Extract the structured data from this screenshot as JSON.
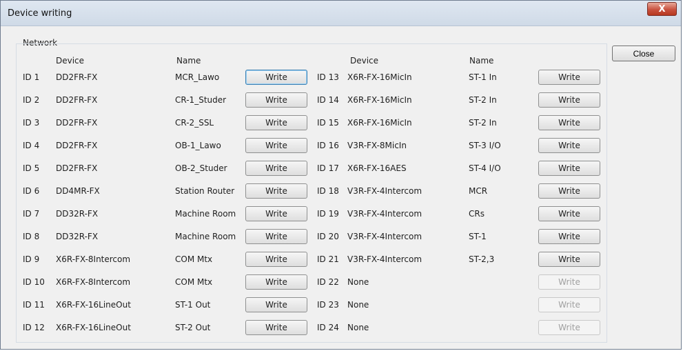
{
  "window": {
    "title": "Device writing",
    "close_glyph": "X"
  },
  "network": {
    "group_label": "Network",
    "headers": {
      "device": "Device",
      "name": "Name"
    },
    "left": [
      {
        "id": "ID 1",
        "device": "DD2FR-FX",
        "name": "MCR_Lawo",
        "write": "Write",
        "enabled": true
      },
      {
        "id": "ID 2",
        "device": "DD2FR-FX",
        "name": "CR-1_Studer",
        "write": "Write",
        "enabled": true
      },
      {
        "id": "ID 3",
        "device": "DD2FR-FX",
        "name": "CR-2_SSL",
        "write": "Write",
        "enabled": true
      },
      {
        "id": "ID 4",
        "device": "DD2FR-FX",
        "name": "OB-1_Lawo",
        "write": "Write",
        "enabled": true
      },
      {
        "id": "ID 5",
        "device": "DD2FR-FX",
        "name": "OB-2_Studer",
        "write": "Write",
        "enabled": true
      },
      {
        "id": "ID 6",
        "device": "DD4MR-FX",
        "name": "Station Router",
        "write": "Write",
        "enabled": true
      },
      {
        "id": "ID 7",
        "device": "DD32R-FX",
        "name": "Machine Room",
        "write": "Write",
        "enabled": true
      },
      {
        "id": "ID 8",
        "device": "DD32R-FX",
        "name": "Machine Room",
        "write": "Write",
        "enabled": true
      },
      {
        "id": "ID 9",
        "device": "X6R-FX-8Intercom",
        "name": "COM Mtx",
        "write": "Write",
        "enabled": true
      },
      {
        "id": "ID 10",
        "device": "X6R-FX-8Intercom",
        "name": "COM Mtx",
        "write": "Write",
        "enabled": true
      },
      {
        "id": "ID 11",
        "device": "X6R-FX-16LineOut",
        "name": "ST-1 Out",
        "write": "Write",
        "enabled": true
      },
      {
        "id": "ID 12",
        "device": "X6R-FX-16LineOut",
        "name": "ST-2 Out",
        "write": "Write",
        "enabled": true
      }
    ],
    "right": [
      {
        "id": "ID 13",
        "device": "X6R-FX-16MicIn",
        "name": "ST-1 In",
        "write": "Write",
        "enabled": true
      },
      {
        "id": "ID 14",
        "device": "X6R-FX-16MicIn",
        "name": "ST-2 In",
        "write": "Write",
        "enabled": true
      },
      {
        "id": "ID 15",
        "device": "X6R-FX-16MicIn",
        "name": "ST-2 In",
        "write": "Write",
        "enabled": true
      },
      {
        "id": "ID 16",
        "device": "V3R-FX-8MicIn",
        "name": "ST-3 I/O",
        "write": "Write",
        "enabled": true
      },
      {
        "id": "ID 17",
        "device": "X6R-FX-16AES",
        "name": "ST-4 I/O",
        "write": "Write",
        "enabled": true
      },
      {
        "id": "ID 18",
        "device": "V3R-FX-4Intercom",
        "name": "MCR",
        "write": "Write",
        "enabled": true
      },
      {
        "id": "ID 19",
        "device": "V3R-FX-4Intercom",
        "name": "CRs",
        "write": "Write",
        "enabled": true
      },
      {
        "id": "ID 20",
        "device": "V3R-FX-4Intercom",
        "name": "ST-1",
        "write": "Write",
        "enabled": true
      },
      {
        "id": "ID 21",
        "device": "V3R-FX-4Intercom",
        "name": "ST-2,3",
        "write": "Write",
        "enabled": true
      },
      {
        "id": "ID 22",
        "device": "None",
        "name": "",
        "write": "Write",
        "enabled": false
      },
      {
        "id": "ID 23",
        "device": "None",
        "name": "",
        "write": "Write",
        "enabled": false
      },
      {
        "id": "ID 24",
        "device": "None",
        "name": "",
        "write": "Write",
        "enabled": false
      }
    ]
  },
  "close_button": "Close"
}
